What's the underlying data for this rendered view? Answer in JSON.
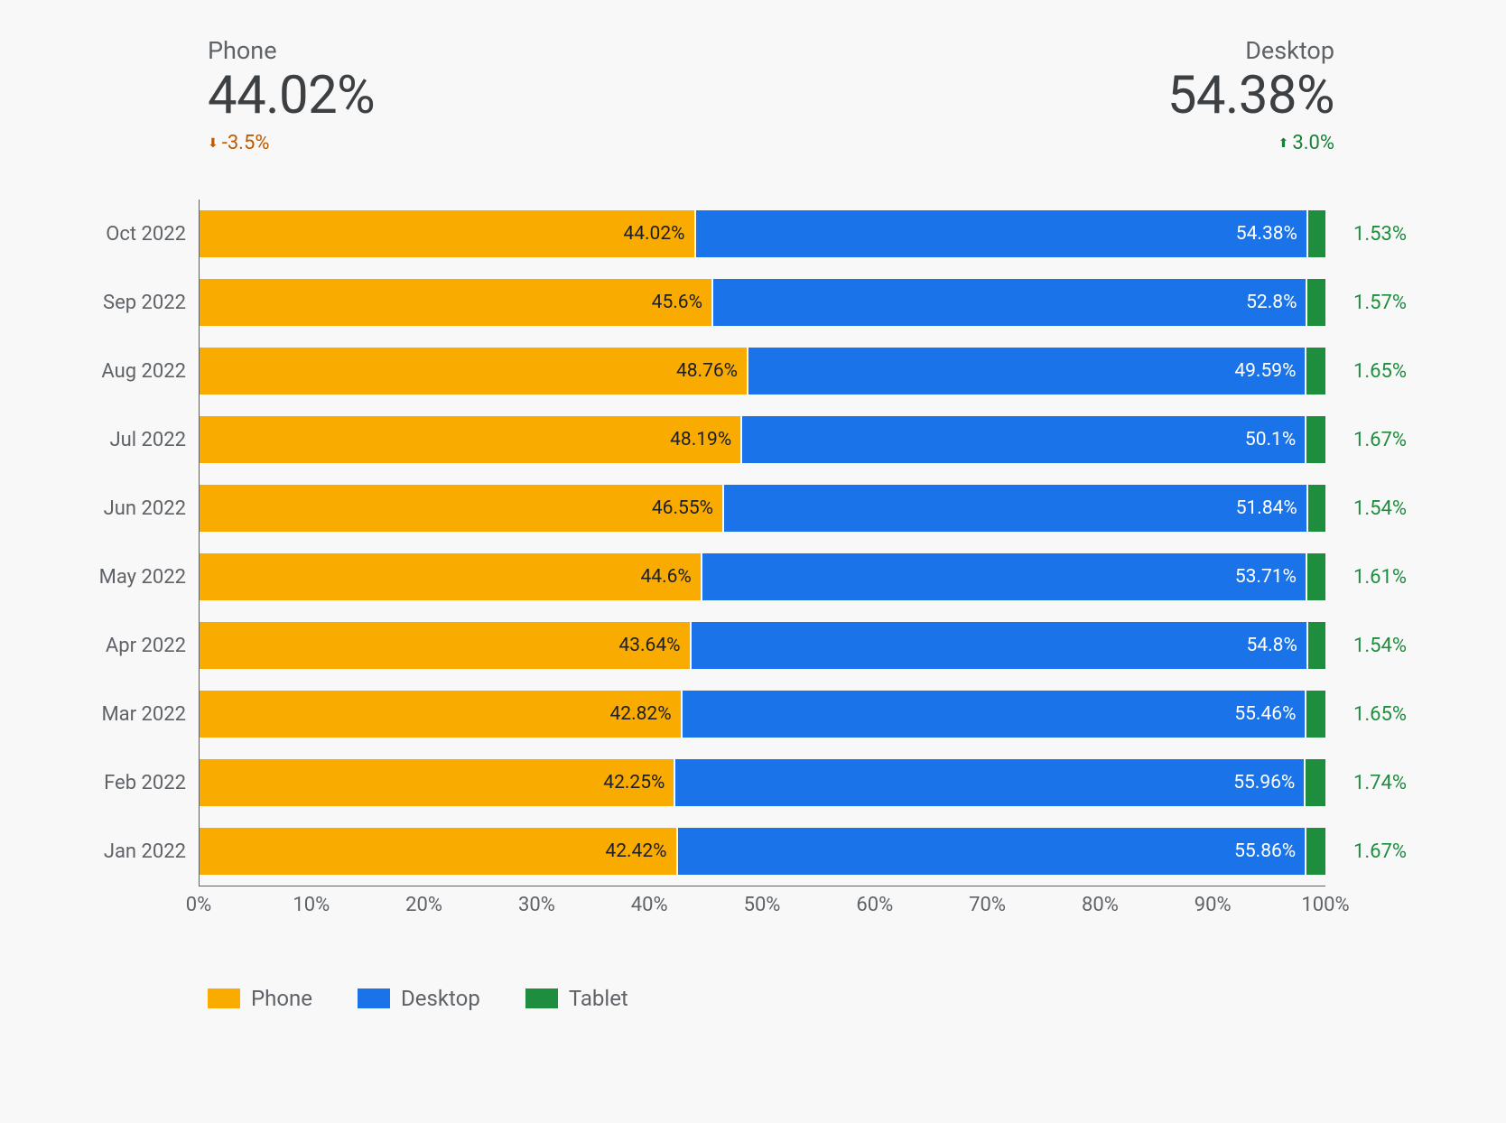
{
  "metrics": {
    "phone": {
      "title": "Phone",
      "value": "44.02%",
      "delta": "-3.5%",
      "dir": "down"
    },
    "desktop": {
      "title": "Desktop",
      "value": "54.38%",
      "delta": "3.0%",
      "dir": "up"
    }
  },
  "legend": {
    "phone": "Phone",
    "desktop": "Desktop",
    "tablet": "Tablet"
  },
  "x_ticks": [
    "0%",
    "10%",
    "20%",
    "30%",
    "40%",
    "50%",
    "60%",
    "70%",
    "80%",
    "90%",
    "100%"
  ],
  "colors": {
    "phone": "#f9ab00",
    "desktop": "#1a73e8",
    "tablet": "#1e8e3e"
  },
  "chart_data": {
    "type": "bar",
    "stacked": true,
    "orientation": "horizontal",
    "xlabel": "",
    "ylabel": "",
    "xlim": [
      0,
      100
    ],
    "categories": [
      "Oct 2022",
      "Sep 2022",
      "Aug 2022",
      "Jul 2022",
      "Jun 2022",
      "May 2022",
      "Apr 2022",
      "Mar 2022",
      "Feb 2022",
      "Jan 2022"
    ],
    "series": [
      {
        "name": "Phone",
        "values": [
          44.02,
          45.6,
          48.76,
          48.19,
          46.55,
          44.6,
          43.64,
          42.82,
          42.25,
          42.42
        ]
      },
      {
        "name": "Desktop",
        "values": [
          54.38,
          52.8,
          49.59,
          50.1,
          51.84,
          53.71,
          54.8,
          55.46,
          55.96,
          55.86
        ]
      },
      {
        "name": "Tablet",
        "values": [
          1.53,
          1.57,
          1.65,
          1.67,
          1.54,
          1.61,
          1.54,
          1.65,
          1.74,
          1.67
        ]
      }
    ]
  }
}
